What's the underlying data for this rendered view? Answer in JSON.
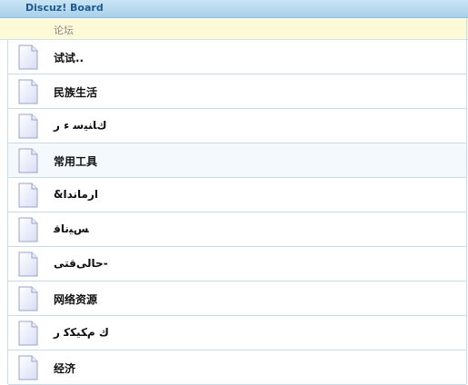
{
  "header": {
    "title": "Discuz! Board"
  },
  "category": {
    "label": "论坛"
  },
  "icons": {
    "forum": "document-icon"
  },
  "colors": {
    "header_bg": "#b7daf0",
    "category_bg": "#fefad7",
    "title_text": "#1e5a8e",
    "divider": "#c7dbea"
  },
  "forums": [
    {
      "name": "试试.."
    },
    {
      "name": "民族生活"
    },
    {
      "name": "ﻙﺎﻨﻴﺳ ﺀ ﺭ"
    },
    {
      "name": "常用工具",
      "highlighted": true
    },
    {
      "name": "&ﺍﺭﻣﺎﻧﺪﺍ"
    },
    {
      "name": "ﺲﻴﻧﺎﻗ"
    },
    {
      "name": "ﺣﺎﻟﻰﻗﺘﻰ-"
    },
    {
      "name": "网络资源"
    },
    {
      "name": "ﻙ ﻡﻜﻴﻜﻛ ﺭ"
    },
    {
      "name": "经济"
    }
  ]
}
